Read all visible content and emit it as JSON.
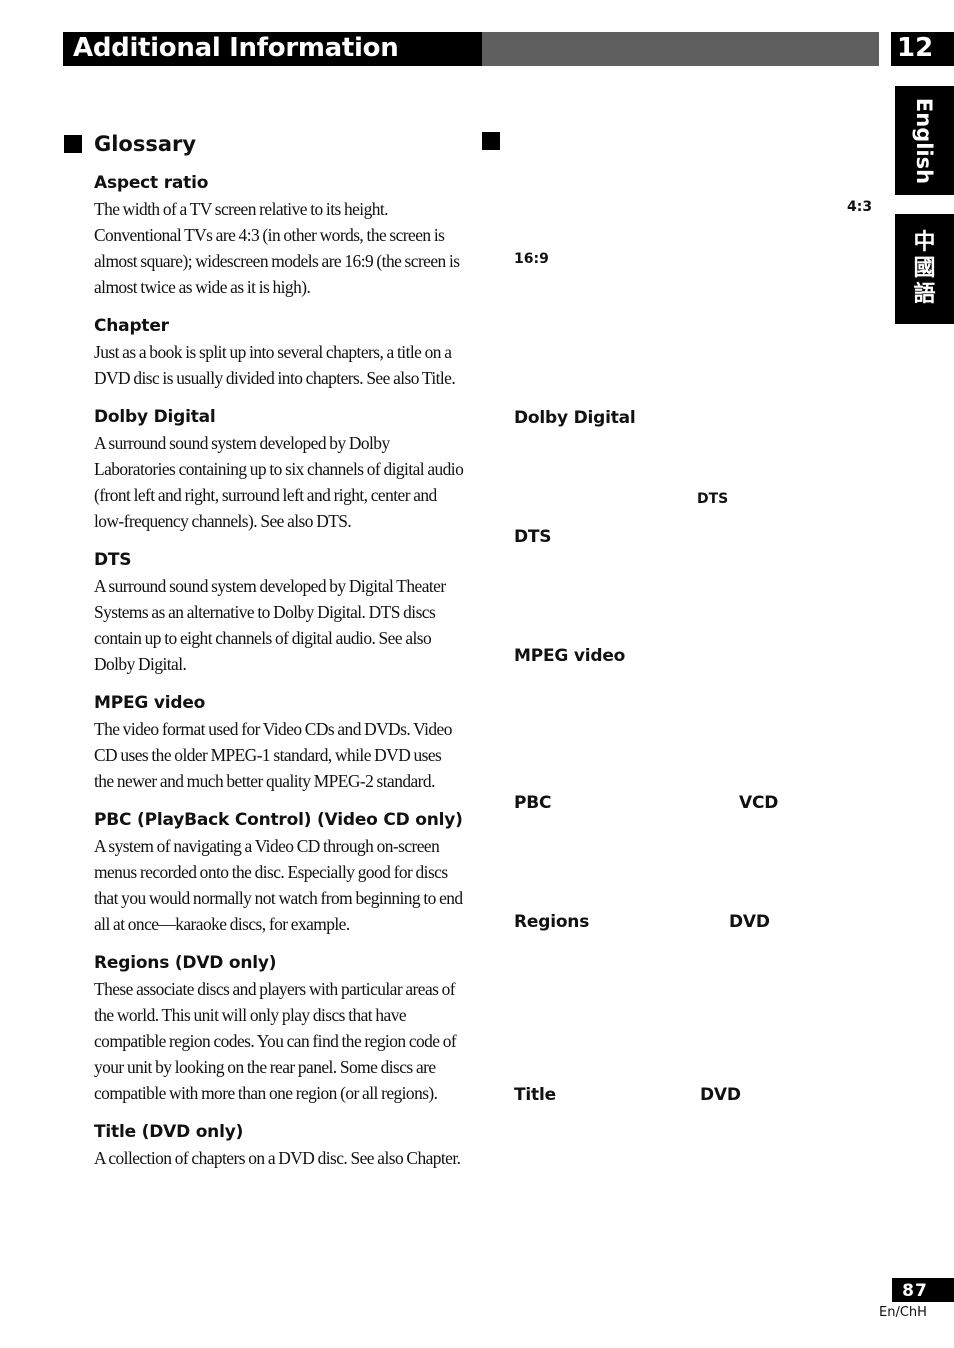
{
  "header": {
    "section_title": "Additional Information",
    "chapter_number": "12"
  },
  "side_tabs": {
    "english": "English",
    "chinese": [
      "中",
      "國",
      "語"
    ]
  },
  "glossary": {
    "title": "Glossary",
    "entries": [
      {
        "term": "Aspect ratio",
        "definition": "The width of a TV screen relative to its height. Conventional TVs are 4:3 (in other words, the screen is almost square); widescreen models are 16:9 (the screen is almost twice as wide as it is high)."
      },
      {
        "term": "Chapter",
        "definition": "Just as a book is split up into several chapters, a title on a DVD disc is usually divided into chapters. See also Title."
      },
      {
        "term": "Dolby Digital",
        "definition": "A surround sound system developed by Dolby Laboratories containing up to six channels of digital audio (front left and right, surround left and right, center and low-frequency channels). See also DTS."
      },
      {
        "term": "DTS",
        "definition": "A surround sound system developed by Digital Theater Systems as an alternative to Dolby Digital. DTS discs contain up to eight channels of digital audio. See also Dolby Digital."
      },
      {
        "term": "MPEG video",
        "definition": "The video format used for Video CDs and DVDs. Video CD uses the older MPEG-1 standard, while DVD uses the newer and much better quality MPEG-2 standard."
      },
      {
        "term": "PBC (PlayBack Control) (Video CD only)",
        "definition": "A system of navigating a Video CD through on-screen menus recorded onto the disc. Especially good for discs that you would normally not watch from beginning to end all at once—karaoke discs, for example."
      },
      {
        "term": "Regions (DVD only)",
        "definition": "These associate discs and players with particular areas of the world. This unit will only play discs that have compatible region codes. You can find the region code of your unit by looking on the rear panel. Some discs are compatible with more than one region (or all regions)."
      },
      {
        "term": "Title (DVD only)",
        "definition": "A collection of chapters on a DVD disc. See also Chapter."
      }
    ]
  },
  "chinese_column": {
    "labels": {
      "ratio_4_3": "4:3",
      "ratio_16_9": "16:9",
      "dolby_digital": "Dolby Digital",
      "dts_inline": "DTS",
      "dts": "DTS",
      "mpeg_video": "MPEG video",
      "pbc": "PBC",
      "vcd": "VCD",
      "regions": "Regions",
      "regions_dvd": "DVD",
      "title": "Title",
      "title_dvd": "DVD"
    }
  },
  "footer": {
    "page_number": "87",
    "language_code": "En/ChH"
  }
}
